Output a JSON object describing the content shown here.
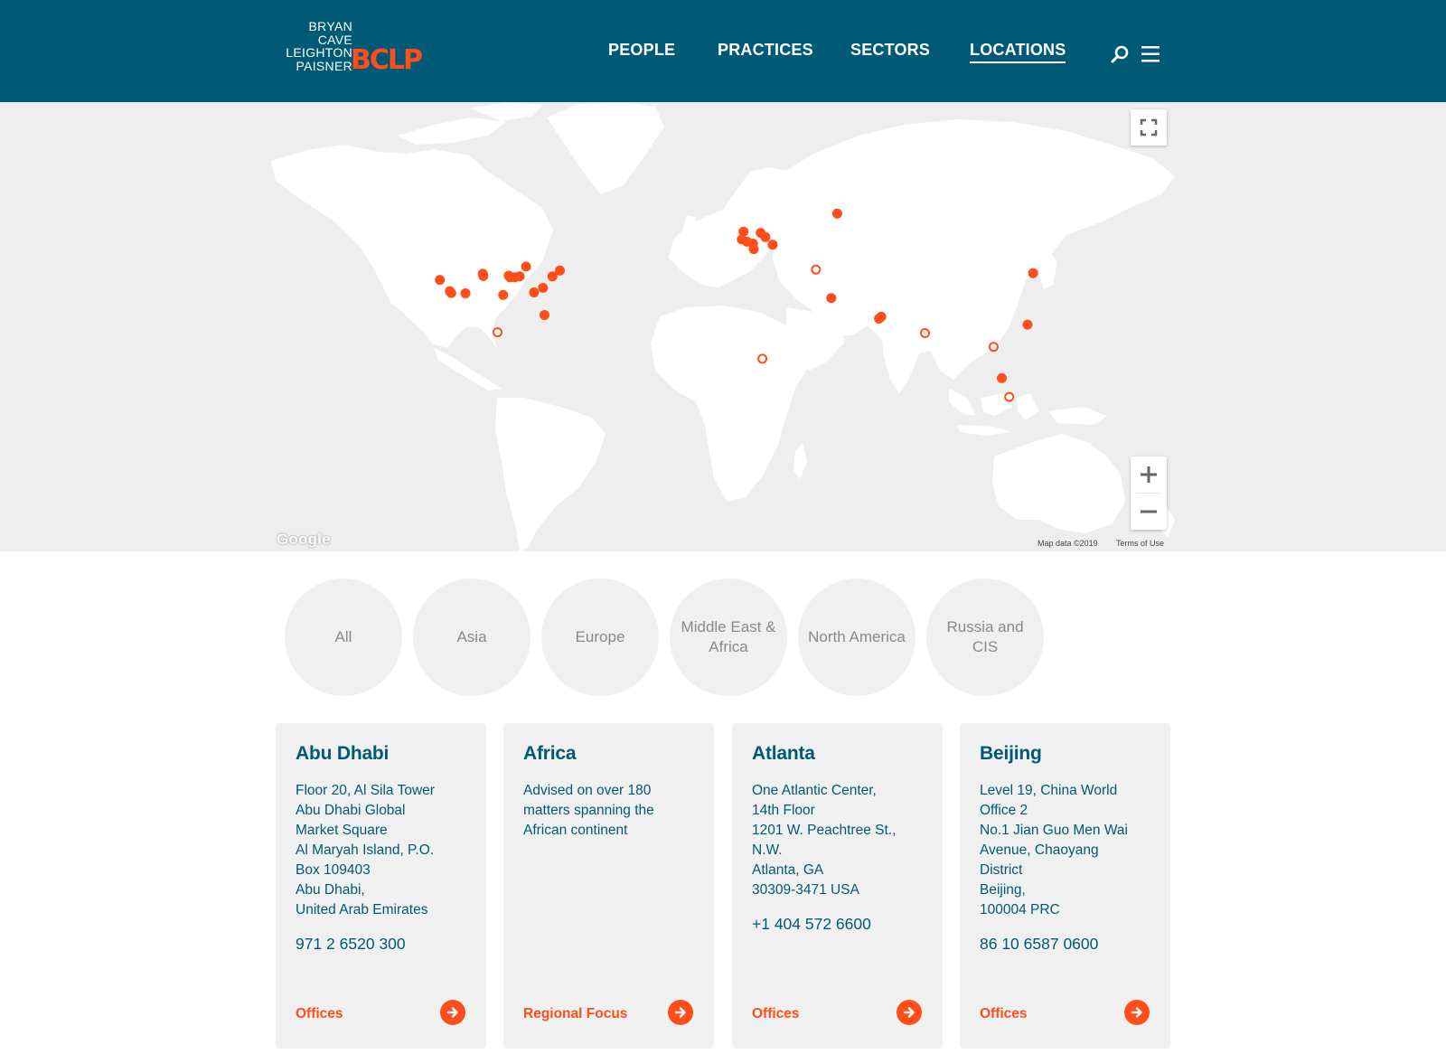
{
  "header": {
    "logo_lines": [
      "BRYAN",
      "CAVE",
      "LEIGHTON",
      "PAISNER"
    ],
    "logo_mark": "BCLP",
    "nav": [
      {
        "label": "PEOPLE"
      },
      {
        "label": "PRACTICES"
      },
      {
        "label": "SECTORS"
      },
      {
        "label": "LOCATIONS",
        "active": true
      }
    ],
    "icons": [
      "search-icon",
      "menu-icon"
    ]
  },
  "map": {
    "google_label": "Google",
    "map_data": "Map data ©2019",
    "terms": "Terms of Use",
    "controls": [
      "fullscreen-icon",
      "zoom-in-icon",
      "zoom-out-icon"
    ],
    "marker_color": "#ff4e1a",
    "markers": [
      {
        "lat": 37.8,
        "lon": -122.3,
        "type": "office"
      },
      {
        "lat": 34.1,
        "lon": -118.3,
        "type": "office"
      },
      {
        "lat": 33.5,
        "lon": -117.7,
        "type": "office"
      },
      {
        "lat": 33.4,
        "lon": -112.0,
        "type": "office"
      },
      {
        "lat": 39.7,
        "lon": -105.0,
        "type": "office"
      },
      {
        "lat": 39.0,
        "lon": -104.8,
        "type": "office"
      },
      {
        "lat": 39.1,
        "lon": -94.6,
        "type": "office"
      },
      {
        "lat": 38.6,
        "lon": -94.0,
        "type": "office"
      },
      {
        "lat": 38.6,
        "lon": -92.2,
        "type": "office"
      },
      {
        "lat": 38.9,
        "lon": -90.2,
        "type": "office"
      },
      {
        "lat": 41.9,
        "lon": -87.6,
        "type": "office"
      },
      {
        "lat": 32.8,
        "lon": -96.8,
        "type": "office"
      },
      {
        "lat": 33.7,
        "lon": -84.4,
        "type": "office"
      },
      {
        "lat": 35.2,
        "lon": -80.8,
        "type": "office"
      },
      {
        "lat": 38.9,
        "lon": -77.0,
        "type": "office"
      },
      {
        "lat": 40.7,
        "lon": -74.0,
        "type": "office"
      },
      {
        "lat": 25.8,
        "lon": -80.2,
        "type": "office"
      },
      {
        "lat": 19.4,
        "lon": -99.1,
        "type": "focus"
      },
      {
        "lat": 51.5,
        "lon": -0.1,
        "type": "office"
      },
      {
        "lat": 49.5,
        "lon": -0.8,
        "type": "office"
      },
      {
        "lat": 48.9,
        "lon": 1.3,
        "type": "office"
      },
      {
        "lat": 48.4,
        "lon": 3.7,
        "type": "office"
      },
      {
        "lat": 46.9,
        "lon": 4.0,
        "type": "office"
      },
      {
        "lat": 51.2,
        "lon": 6.8,
        "type": "office"
      },
      {
        "lat": 50.1,
        "lon": 8.7,
        "type": "office"
      },
      {
        "lat": 48.1,
        "lon": 11.6,
        "type": "office"
      },
      {
        "lat": 55.8,
        "lon": 37.6,
        "type": "office"
      },
      {
        "lat": 41.0,
        "lon": 29.0,
        "type": "focus"
      },
      {
        "lat": 31.8,
        "lon": 35.2,
        "type": "office"
      },
      {
        "lat": 24.5,
        "lon": 54.4,
        "type": "office"
      },
      {
        "lat": 25.2,
        "lon": 55.3,
        "type": "office"
      },
      {
        "lat": 9.1,
        "lon": 7.5,
        "type": "focus"
      },
      {
        "lat": 19.1,
        "lon": 72.9,
        "type": "focus"
      },
      {
        "lat": 13.8,
        "lon": 100.5,
        "type": "focus"
      },
      {
        "lat": 39.9,
        "lon": 116.4,
        "type": "office"
      },
      {
        "lat": 22.3,
        "lon": 114.2,
        "type": "office"
      },
      {
        "lat": 1.3,
        "lon": 103.8,
        "type": "office"
      },
      {
        "lat": -6.2,
        "lon": 106.8,
        "type": "focus"
      }
    ]
  },
  "filters": [
    "All",
    "Asia",
    "Europe",
    "Middle East & Africa",
    "North America",
    "Russia and CIS"
  ],
  "cards": [
    {
      "title": "Abu Dhabi",
      "address": [
        "Floor 20, Al Sila Tower",
        "Abu Dhabi Global",
        "Market Square",
        "Al Maryah Island, P.O.",
        "Box 109403",
        "Abu Dhabi,",
        "United Arab Emirates"
      ],
      "phone": "971 2 6520 300",
      "link": "Offices"
    },
    {
      "title": "Africa",
      "address": [
        "Advised on over 180",
        "matters spanning the",
        "African continent"
      ],
      "phone": "",
      "link": "Regional Focus"
    },
    {
      "title": "Atlanta",
      "address": [
        "One Atlantic Center,",
        "14th Floor",
        "1201 W. Peachtree St.,",
        "N.W.",
        "Atlanta, GA",
        "30309-3471 USA"
      ],
      "phone": "+1 404 572 6600",
      "link": "Offices"
    },
    {
      "title": "Beijing",
      "address": [
        "Level 19, China World",
        "Office 2",
        "No.1 Jian Guo Men Wai",
        "Avenue, Chaoyang",
        "District",
        "Beijing,",
        "100004 PRC"
      ],
      "phone": "86 10 6587 0600",
      "link": "Offices"
    }
  ]
}
